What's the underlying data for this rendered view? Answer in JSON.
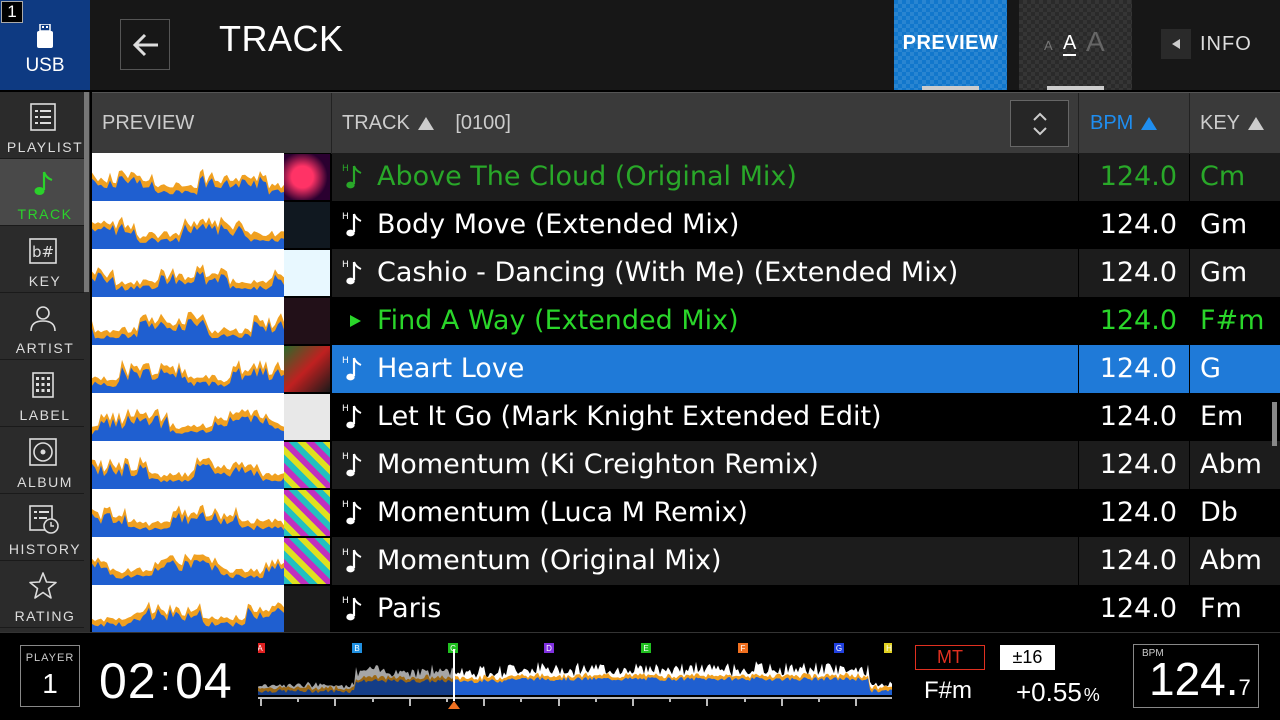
{
  "header": {
    "player_number": "1",
    "source_label": "USB",
    "title": "TRACK",
    "preview_label": "PREVIEW",
    "font_small": "A",
    "font_medium": "A",
    "font_large": "A",
    "info_label": "INFO"
  },
  "sidebar": {
    "items": [
      {
        "label": "PLAYLIST",
        "icon": "playlist-icon"
      },
      {
        "label": "TRACK",
        "icon": "music-note-icon",
        "active": true
      },
      {
        "label": "KEY",
        "icon": "key-icon"
      },
      {
        "label": "ARTIST",
        "icon": "person-icon"
      },
      {
        "label": "LABEL",
        "icon": "label-grid-icon"
      },
      {
        "label": "ALBUM",
        "icon": "disc-icon"
      },
      {
        "label": "HISTORY",
        "icon": "history-icon"
      },
      {
        "label": "RATING",
        "icon": "star-icon"
      }
    ]
  },
  "table": {
    "col_preview": "PREVIEW",
    "col_track": "TRACK",
    "track_count": "[0100]",
    "col_bpm": "BPM",
    "col_key": "KEY",
    "accent_color": "#1f7ad8",
    "rows": [
      {
        "title": "Above The Cloud (Original Mix)",
        "bpm": "124.0",
        "key": "Cm",
        "state": "done"
      },
      {
        "title": "Body Move (Extended Mix)",
        "bpm": "124.0",
        "key": "Gm",
        "state": "normal"
      },
      {
        "title": "Cashio - Dancing (With Me) (Extended Mix)",
        "bpm": "124.0",
        "key": "Gm",
        "state": "normal"
      },
      {
        "title": "Find A Way (Extended Mix)",
        "bpm": "124.0",
        "key": "F#m",
        "state": "loaded"
      },
      {
        "title": "Heart Love",
        "bpm": "124.0",
        "key": "G",
        "state": "selected"
      },
      {
        "title": "Let It Go (Mark Knight Extended Edit)",
        "bpm": "124.0",
        "key": "Em",
        "state": "normal"
      },
      {
        "title": "Momentum (Ki Creighton Remix)",
        "bpm": "124.0",
        "key": "Abm",
        "state": "normal"
      },
      {
        "title": "Momentum (Luca M Remix)",
        "bpm": "124.0",
        "key": "Db",
        "state": "normal"
      },
      {
        "title": "Momentum (Original Mix)",
        "bpm": "124.0",
        "key": "Abm",
        "state": "normal"
      },
      {
        "title": "Paris",
        "bpm": "124.0",
        "key": "Fm",
        "state": "normal"
      }
    ]
  },
  "footer": {
    "player_label": "PLAYER",
    "player_number": "1",
    "time_min": "02",
    "time_sep": ":",
    "time_sec": "04",
    "hot_cues": [
      "A",
      "B",
      "C",
      "D",
      "E",
      "F",
      "G",
      "H"
    ],
    "master_tempo": "MT",
    "tempo_range": "±16",
    "key": "F#m",
    "pitch": "+0.55",
    "pitch_unit": "%",
    "bpm_label": "BPM",
    "bpm_int": "124.",
    "bpm_dec": "7"
  }
}
